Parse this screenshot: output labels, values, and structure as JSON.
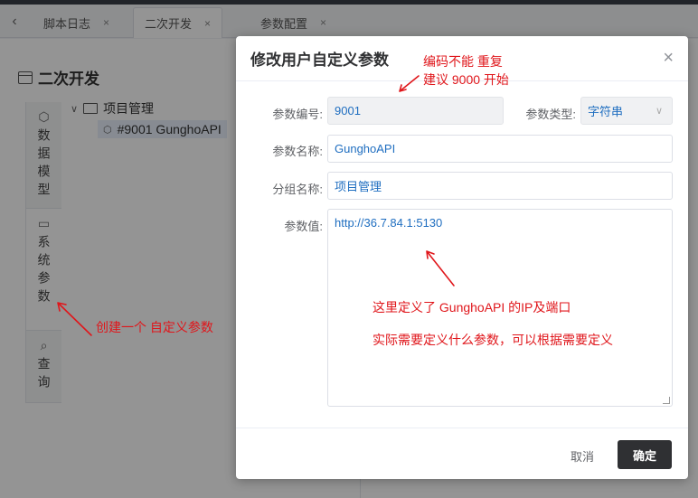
{
  "tabs": [
    {
      "label": "脚本日志",
      "close": "×"
    },
    {
      "label": "二次开发",
      "close": "×"
    },
    {
      "label": "参数配置",
      "close": "×"
    }
  ],
  "back_label": "‹",
  "page": {
    "title": "二次开发"
  },
  "sidebar": {
    "items": [
      {
        "label": "数据模型",
        "icon": "cube-icon"
      },
      {
        "label": "系统参数",
        "icon": "monitor-icon"
      },
      {
        "label": "查询",
        "icon": "search-icon"
      }
    ]
  },
  "tree": {
    "root": "项目管理",
    "child": "#9001 GunghoAPI"
  },
  "dialog": {
    "title": "修改用户自定义参数",
    "close": "×",
    "fields": {
      "code_label": "参数编号:",
      "code_value": "9001",
      "type_label": "参数类型:",
      "type_value": "字符串",
      "name_label": "参数名称:",
      "name_value": "GunghoAPI",
      "group_label": "分组名称:",
      "group_value": "项目管理",
      "value_label": "参数值:",
      "value_value": "http://36.7.84.1:5130"
    },
    "cancel_label": "取消",
    "ok_label": "确定"
  },
  "annotations": {
    "code_note_1": "编码不能 重复",
    "code_note_2": "建议  9000 开始",
    "value_note_1": "这里定义了 GunghoAPI 的IP及端口",
    "value_note_2": "实际需要定义什么参数，可以根据需要定义",
    "side_note": "创建一个 自定义参数"
  },
  "colors": {
    "annotation": "#e0161b",
    "primary_button": "#2f3033",
    "input_text": "#1f6ec0"
  }
}
